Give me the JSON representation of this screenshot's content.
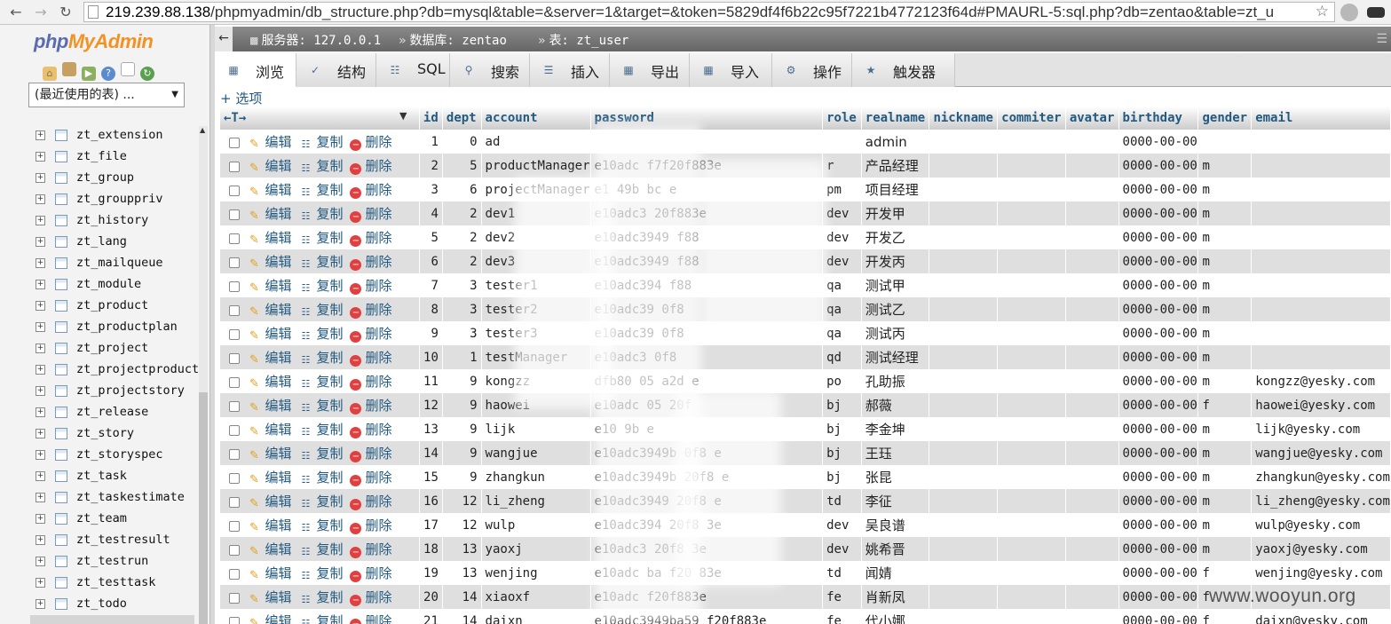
{
  "browser": {
    "url_host": "219.239.88.138",
    "url_rest": "/phpmyadmin/db_structure.php?db=mysql&table=&server=1&target=&token=5829df4f6b22c95f7221b4772123f64d#PMAURL-5:sql.php?db=zentao&table=zt_u"
  },
  "left": {
    "logo_php": "php",
    "logo_ma": "MyAdmin",
    "db_select": "(最近使用的表) ...",
    "tables": [
      "zt_extension",
      "zt_file",
      "zt_group",
      "zt_grouppriv",
      "zt_history",
      "zt_lang",
      "zt_mailqueue",
      "zt_module",
      "zt_product",
      "zt_productplan",
      "zt_project",
      "zt_projectproduct",
      "zt_projectstory",
      "zt_release",
      "zt_story",
      "zt_storyspec",
      "zt_task",
      "zt_taskestimate",
      "zt_team",
      "zt_testresult",
      "zt_testrun",
      "zt_testtask",
      "zt_todo"
    ]
  },
  "breadcrumb": {
    "server": "服务器: 127.0.0.1",
    "database": "数据库: zentao",
    "table": "表: zt_user"
  },
  "tabs": [
    "浏览",
    "结构",
    "SQL",
    "搜索",
    "插入",
    "导出",
    "导入",
    "操作",
    "触发器"
  ],
  "options_link": "+ 选项",
  "grid": {
    "col_arrows": "←T→",
    "columns": [
      "id",
      "dept",
      "account",
      "password",
      "role",
      "realname",
      "nickname",
      "commiter",
      "avatar",
      "birthday",
      "gender",
      "email"
    ],
    "actions": {
      "edit": "编辑",
      "copy": "复制",
      "delete": "删除"
    },
    "rows": [
      {
        "id": "1",
        "dept": "0",
        "account": "ad",
        "password": "",
        "role": "",
        "realname": "admin",
        "birthday": "0000-00-00",
        "gender": "",
        "email": ""
      },
      {
        "id": "2",
        "dept": "5",
        "account": "productManager",
        "password": "e10adc    f7f20f883e",
        "role": "r",
        "realname": "产品经理",
        "birthday": "0000-00-00",
        "gender": "m",
        "email": ""
      },
      {
        "id": "3",
        "dept": "6",
        "account": "projectManager",
        "password": "e1    49b    bc    e",
        "role": "pm",
        "realname": "项目经理",
        "birthday": "0000-00-00",
        "gender": "m",
        "email": ""
      },
      {
        "id": "4",
        "dept": "2",
        "account": "dev1",
        "password": "e10adc3    20f883e",
        "role": "dev",
        "realname": "开发甲",
        "birthday": "0000-00-00",
        "gender": "m",
        "email": ""
      },
      {
        "id": "5",
        "dept": "2",
        "account": "dev2",
        "password": "e10adc3949    f88",
        "role": "dev",
        "realname": "开发乙",
        "birthday": "0000-00-00",
        "gender": "m",
        "email": ""
      },
      {
        "id": "6",
        "dept": "2",
        "account": "dev3",
        "password": "e10adc3949    f88",
        "role": "dev",
        "realname": "开发丙",
        "birthday": "0000-00-00",
        "gender": "m",
        "email": ""
      },
      {
        "id": "7",
        "dept": "3",
        "account": "tester1",
        "password": "e10adc394    f88",
        "role": "qa",
        "realname": "测试甲",
        "birthday": "0000-00-00",
        "gender": "m",
        "email": ""
      },
      {
        "id": "8",
        "dept": "3",
        "account": "tester2",
        "password": "e10adc39    0f8",
        "role": "qa",
        "realname": "测试乙",
        "birthday": "0000-00-00",
        "gender": "m",
        "email": ""
      },
      {
        "id": "9",
        "dept": "3",
        "account": "tester3",
        "password": "e10adc39    0f8",
        "role": "qa",
        "realname": "测试丙",
        "birthday": "0000-00-00",
        "gender": "m",
        "email": ""
      },
      {
        "id": "10",
        "dept": "1",
        "account": "testManager",
        "password": "e10adc3    0f8",
        "role": "qd",
        "realname": "测试经理",
        "birthday": "0000-00-00",
        "gender": "m",
        "email": ""
      },
      {
        "id": "11",
        "dept": "9",
        "account": "kongzz",
        "password": "dfb80    05  a2d e",
        "role": "po",
        "realname": "孔助振",
        "birthday": "0000-00-00",
        "gender": "m",
        "email": "kongzz@yesky.com"
      },
      {
        "id": "12",
        "dept": "9",
        "account": "haowei",
        "password": "e10adc    05  20f",
        "role": "bj",
        "realname": "郝薇",
        "birthday": "0000-00-00",
        "gender": "f",
        "email": "haowei@yesky.com"
      },
      {
        "id": "13",
        "dept": "9",
        "account": "lijk",
        "password": "e10    9b    e",
        "role": "bj",
        "realname": "李金坤",
        "birthday": "0000-00-00",
        "gender": "m",
        "email": "lijk@yesky.com"
      },
      {
        "id": "14",
        "dept": "9",
        "account": "wangjue",
        "password": "e10adc3949b    0f8 e",
        "role": "bj",
        "realname": "王珏",
        "birthday": "0000-00-00",
        "gender": "m",
        "email": "wangjue@yesky.com"
      },
      {
        "id": "15",
        "dept": "9",
        "account": "zhangkun",
        "password": "e10adc3949b    20f8 e",
        "role": "bj",
        "realname": "张昆",
        "birthday": "0000-00-00",
        "gender": "m",
        "email": "zhangkun@yesky.com"
      },
      {
        "id": "16",
        "dept": "12",
        "account": "li_zheng",
        "password": "e10adc3949    20f8 e",
        "role": "td",
        "realname": "李征",
        "birthday": "0000-00-00",
        "gender": "m",
        "email": "li_zheng@yesky.com"
      },
      {
        "id": "17",
        "dept": "12",
        "account": "wulp",
        "password": "e10adc394    20f8 3e",
        "role": "dev",
        "realname": "吴良谱",
        "birthday": "0000-00-00",
        "gender": "m",
        "email": "wulp@yesky.com"
      },
      {
        "id": "18",
        "dept": "13",
        "account": "yaoxj",
        "password": "e10adc3    20f8 3e",
        "role": "dev",
        "realname": "姚希晋",
        "birthday": "0000-00-00",
        "gender": "m",
        "email": "yaoxj@yesky.com"
      },
      {
        "id": "19",
        "dept": "13",
        "account": "wenjing",
        "password": "e10adc    ba    f20 83e",
        "role": "td",
        "realname": "闻婧",
        "birthday": "0000-00-00",
        "gender": "f",
        "email": "wenjing@yesky.com"
      },
      {
        "id": "20",
        "dept": "14",
        "account": "xiaoxf",
        "password": "e10adc    f20f883e",
        "role": "fe",
        "realname": "肖新凤",
        "birthday": "0000-00-00",
        "gender": "f",
        "email": ""
      },
      {
        "id": "21",
        "dept": "14",
        "account": "daixn",
        "password": "e10adc3949ba59    f20f883e",
        "role": "fe",
        "realname": "代小娜",
        "birthday": "0000-00-00",
        "gender": "f",
        "email": "daixn@yesky.com"
      }
    ]
  },
  "watermark": "www.wooyun.org",
  "colors": {
    "link": "#235a81",
    "even_row": "#dfdfdf",
    "topbar": "#777777"
  }
}
